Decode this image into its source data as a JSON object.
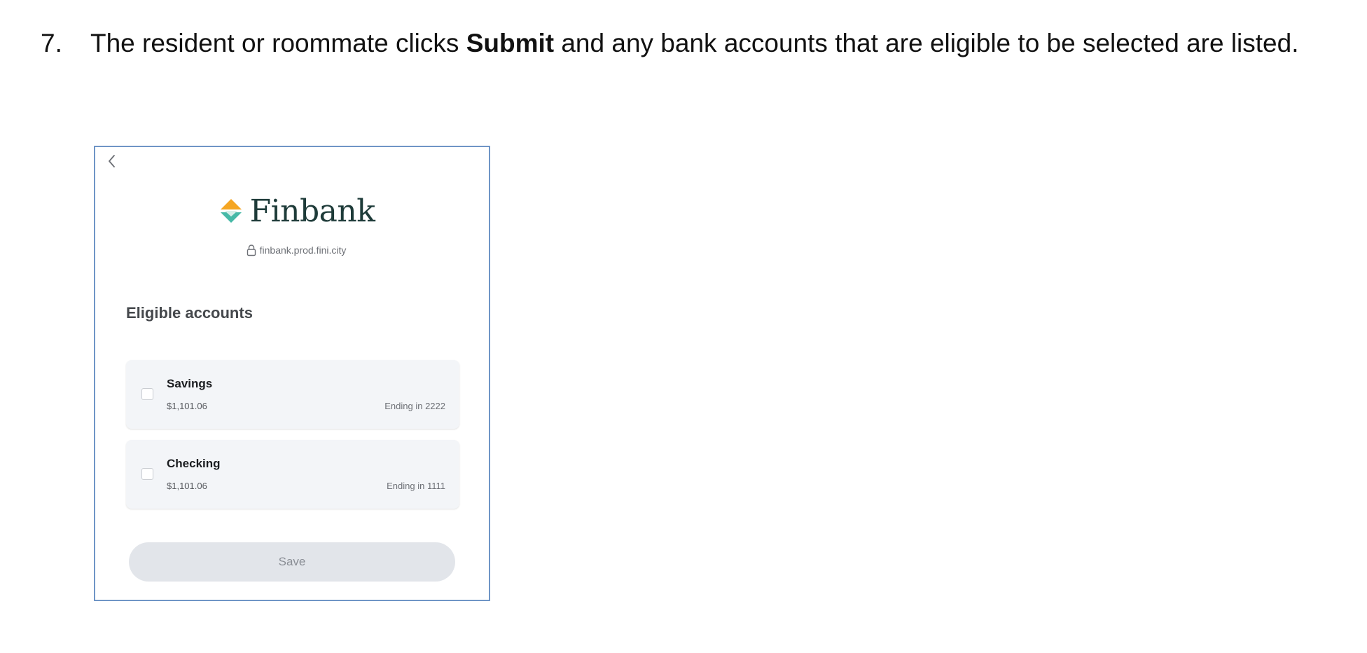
{
  "step": {
    "number": "7.",
    "text_before": "The resident or roommate clicks ",
    "emphasis": "Submit",
    "text_after": " and any bank accounts that are eligible to be selected are listed."
  },
  "screenshot": {
    "back_icon": "chevron-left-icon",
    "logo": {
      "icon": "finbank-diamond-icon",
      "name": "Finbank",
      "colors": {
        "top": "#f5a623",
        "bottom": "#46b9a7"
      }
    },
    "url": {
      "icon": "lock-icon",
      "text": "finbank.prod.fini.city"
    },
    "section_title": "Eligible accounts",
    "accounts": [
      {
        "name": "Savings",
        "balance": "$1,101.06",
        "ending": "Ending in 2222",
        "checked": false
      },
      {
        "name": "Checking",
        "balance": "$1,101.06",
        "ending": "Ending in 1111",
        "checked": false
      }
    ],
    "save_label": "Save",
    "border_color": "#6f95c6"
  }
}
